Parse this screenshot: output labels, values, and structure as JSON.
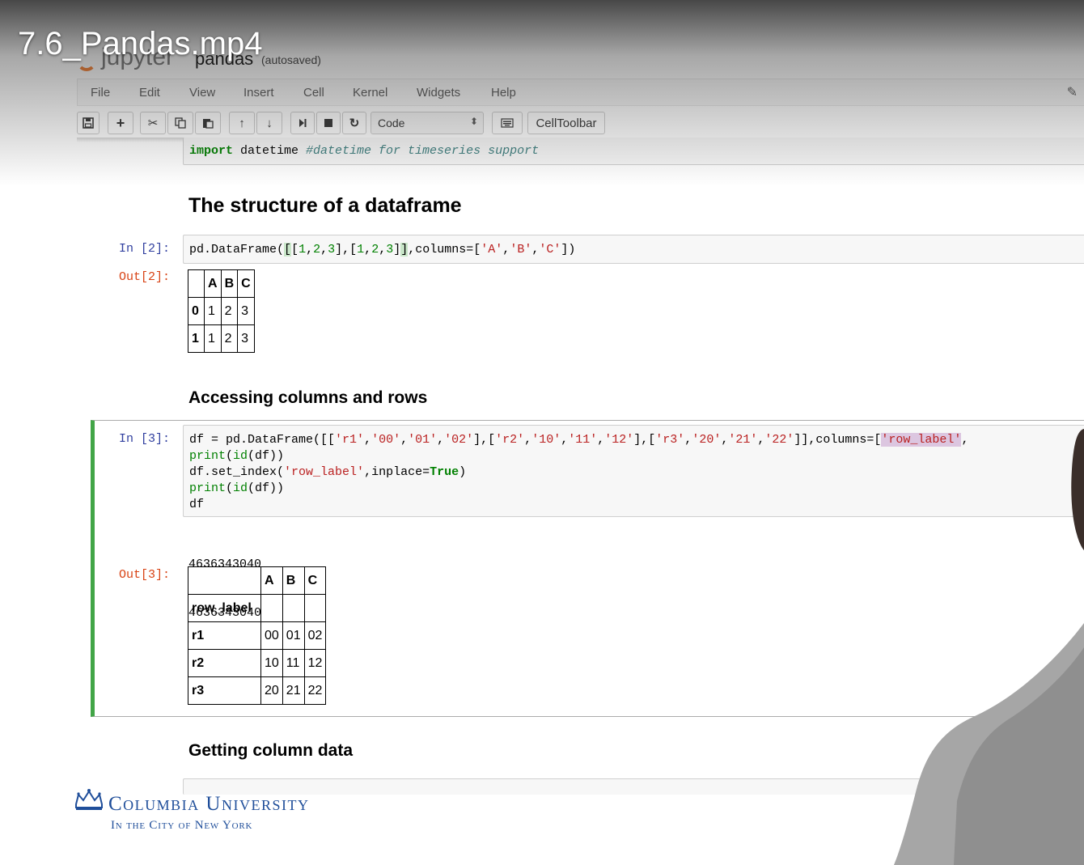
{
  "video": {
    "title": "7.6_Pandas.mp4"
  },
  "header": {
    "logo_text": "jupyter",
    "notebook_name": "pandas",
    "save_status": "(autosaved)"
  },
  "menu": {
    "items": [
      "File",
      "Edit",
      "View",
      "Insert",
      "Cell",
      "Kernel",
      "Widgets",
      "Help"
    ]
  },
  "toolbar": {
    "cell_type": "Code",
    "cell_toolbar_label": "CellToolbar",
    "icons": [
      "save-icon",
      "plus-icon",
      "cut-icon",
      "copy-icon",
      "paste-icon",
      "arrow-up-icon",
      "arrow-down-icon",
      "step-forward-icon",
      "stop-icon",
      "restart-icon",
      "keyboard-icon"
    ]
  },
  "cells": {
    "c1": {
      "line": "import datetime #datetime for timeseries support"
    },
    "h1": "The structure of a dataframe",
    "c2": {
      "prompt_in": "In [2]:",
      "prompt_out": "Out[2]:",
      "code": "pd.DataFrame([[1,2,3],[1,2,3]],columns=['A','B','C'])",
      "table": {
        "columns": [
          "",
          "A",
          "B",
          "C"
        ],
        "rows": [
          [
            "0",
            "1",
            "2",
            "3"
          ],
          [
            "1",
            "1",
            "2",
            "3"
          ]
        ]
      }
    },
    "h2": "Accessing columns and rows",
    "c3": {
      "prompt_in": "In [3]:",
      "prompt_out": "Out[3]:",
      "code_lines": [
        "df = pd.DataFrame([['r1','00','01','02'],['r2','10','11','12'],['r3','20','21','22']],columns=['row_label',",
        "print(id(df))",
        "df.set_index('row_label',inplace=True)",
        "print(id(df))",
        "df"
      ],
      "stdout": [
        "4636343040",
        "4636343040"
      ],
      "table": {
        "columns": [
          "",
          "A",
          "B",
          "C"
        ],
        "index_name": "row_label",
        "rows": [
          [
            "r1",
            "00",
            "01",
            "02"
          ],
          [
            "r2",
            "10",
            "11",
            "12"
          ],
          [
            "r3",
            "20",
            "21",
            "22"
          ]
        ]
      }
    },
    "h3": "Getting column data"
  },
  "branding": {
    "line1": "Columbia University",
    "line2": "In the City of New York"
  },
  "colors": {
    "selected_cell_border": "#42a547",
    "brand_blue": "#1f4e9a",
    "prompt_in": "#303f9f",
    "prompt_out": "#d84315"
  }
}
